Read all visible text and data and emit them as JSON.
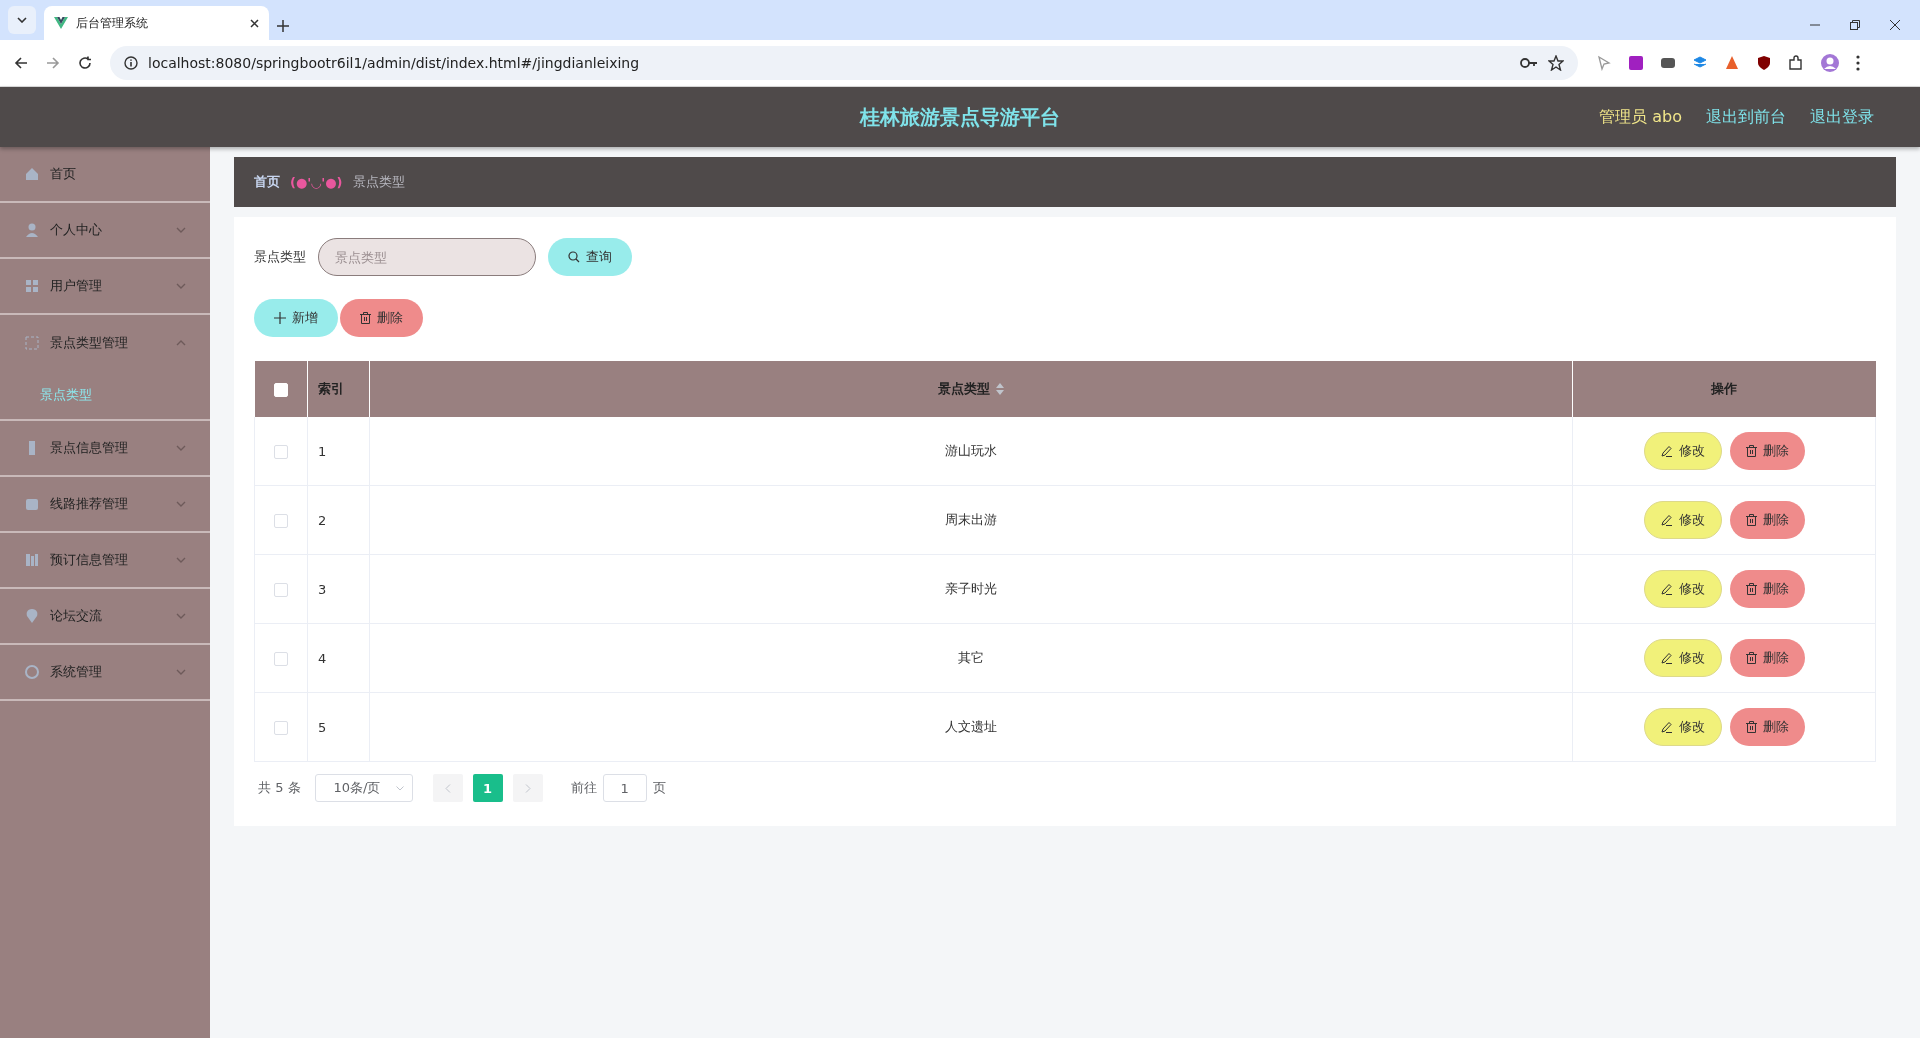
{
  "browser": {
    "tab_title": "后台管理系统",
    "url": "localhost:8080/springbootr6il1/admin/dist/index.html#/jingdianleixing"
  },
  "header": {
    "title": "桂林旅游景点导游平台",
    "user": "管理员 abo",
    "links": [
      "退出到前台",
      "退出登录"
    ]
  },
  "sidebar": {
    "items": [
      {
        "label": "首页",
        "kind": "link"
      },
      {
        "label": "个人中心",
        "kind": "submenu",
        "expanded": false
      },
      {
        "label": "用户管理",
        "kind": "submenu",
        "expanded": false
      },
      {
        "label": "景点类型管理",
        "kind": "submenu",
        "expanded": true,
        "children": [
          {
            "label": "景点类型",
            "selected": true
          }
        ]
      },
      {
        "label": "景点信息管理",
        "kind": "submenu",
        "expanded": false
      },
      {
        "label": "线路推荐管理",
        "kind": "submenu",
        "expanded": false
      },
      {
        "label": "预订信息管理",
        "kind": "submenu",
        "expanded": false
      },
      {
        "label": "论坛交流",
        "kind": "submenu",
        "expanded": false
      },
      {
        "label": "系统管理",
        "kind": "submenu",
        "expanded": false
      }
    ]
  },
  "breadcrumb": {
    "home": "首页",
    "separator": "(●'◡'●)",
    "current": "景点类型"
  },
  "search": {
    "label": "景点类型",
    "placeholder": "景点类型",
    "button": "查询"
  },
  "actions": [
    {
      "label": "新增",
      "kind": "add"
    },
    {
      "label": "删除",
      "kind": "delete"
    }
  ],
  "table": {
    "columns": [
      "索引",
      "景点类型",
      "操作"
    ],
    "all_checked": false,
    "rows": [
      {
        "index": "1",
        "type": "游山玩水",
        "checked": false,
        "buttons": [
          "修改",
          "删除"
        ]
      },
      {
        "index": "2",
        "type": "周末出游",
        "checked": false,
        "buttons": [
          "修改",
          "删除"
        ]
      },
      {
        "index": "3",
        "type": "亲子时光",
        "checked": false,
        "buttons": [
          "修改",
          "删除"
        ]
      },
      {
        "index": "4",
        "type": "其它",
        "checked": false,
        "buttons": [
          "修改",
          "删除"
        ]
      },
      {
        "index": "5",
        "type": "人文遗址",
        "checked": false,
        "buttons": [
          "修改",
          "删除"
        ]
      }
    ]
  },
  "pagination": {
    "total": "共 5 条",
    "page_size": "10条/页",
    "pages": [
      {
        "label": "1",
        "selected": true
      }
    ],
    "goto_label": "前往",
    "goto_value": "1",
    "goto_suffix": "页"
  }
}
